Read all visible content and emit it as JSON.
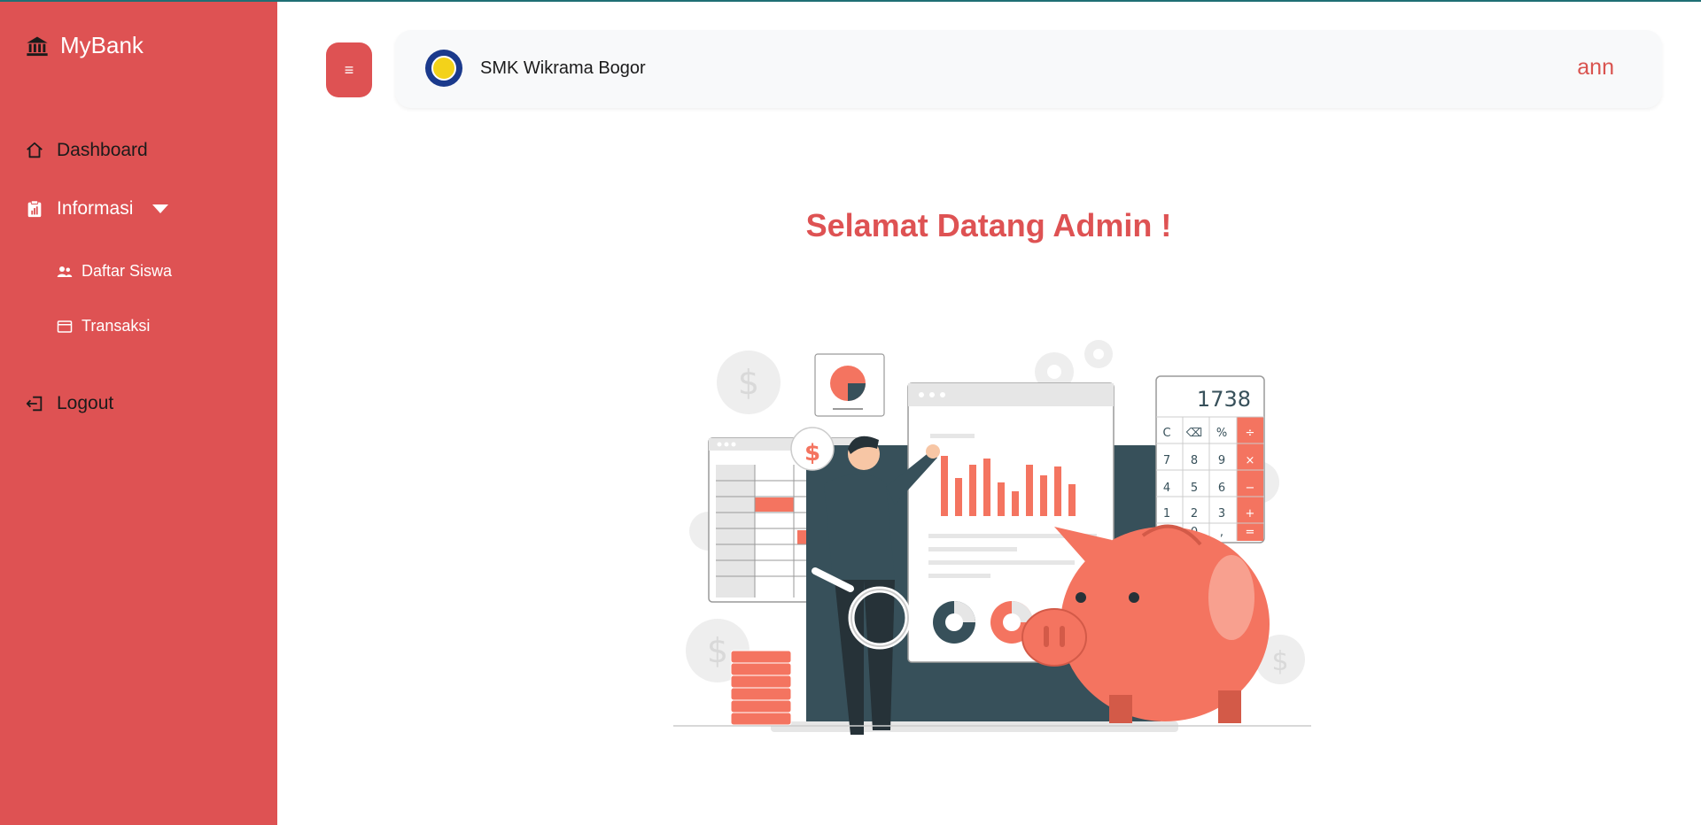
{
  "sidebar": {
    "brand": "MyBank",
    "items": [
      {
        "label": "Dashboard"
      },
      {
        "label": "Informasi"
      },
      {
        "label": "Daftar Siswa"
      },
      {
        "label": "Transaksi"
      },
      {
        "label": "Logout"
      }
    ]
  },
  "header": {
    "menu_icon": "≡",
    "school_name": "SMK Wikrama Bogor",
    "username": "ann"
  },
  "main": {
    "welcome": "Selamat Datang Admin !",
    "illustration": {
      "calculator_display": "1738",
      "keys": [
        "C",
        "⌫",
        "%",
        "÷",
        "7",
        "8",
        "9",
        "×",
        "4",
        "5",
        "6",
        "−",
        "1",
        "2",
        "3",
        "+",
        "0",
        ",",
        "="
      ]
    }
  },
  "colors": {
    "accent": "#de5253",
    "topbar_bg": "#f8f9fa",
    "illustration_accent": "#f47460",
    "dark": "#37505a"
  }
}
